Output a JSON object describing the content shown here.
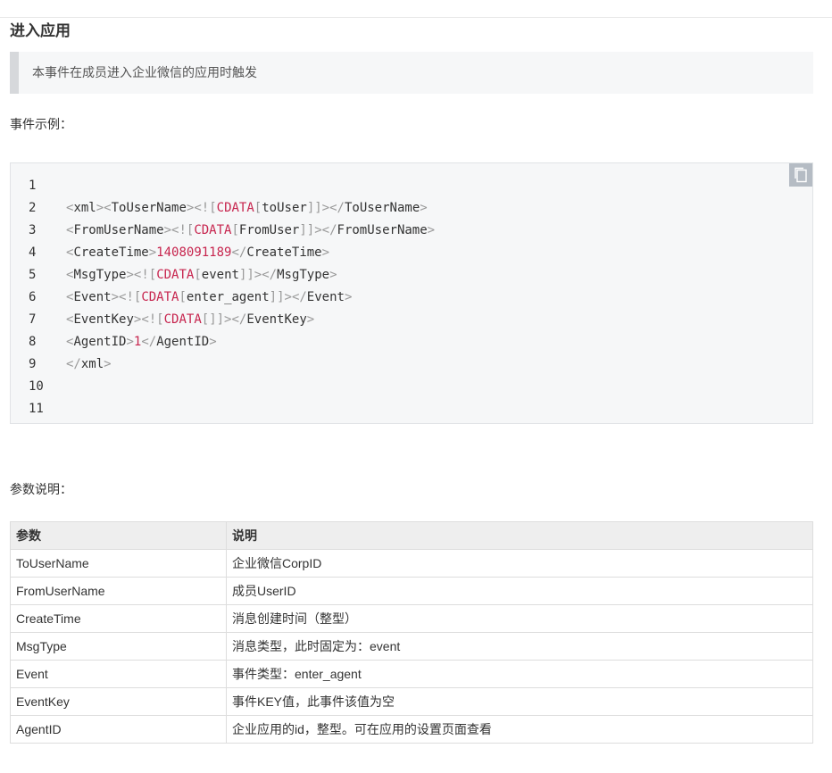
{
  "section": {
    "title": "进入应用",
    "notice": "本事件在成员进入企业微信的应用时触发"
  },
  "example": {
    "label": "事件示例：",
    "copy_icon": "copy-icon",
    "lines": [
      {
        "num": "1",
        "tokens": []
      },
      {
        "num": "2",
        "tokens": [
          {
            "c": "p",
            "t": "<"
          },
          {
            "c": "t",
            "t": "xml"
          },
          {
            "c": "p",
            "t": ">"
          },
          {
            "c": "p",
            "t": "<"
          },
          {
            "c": "t",
            "t": "ToUserName"
          },
          {
            "c": "p",
            "t": ">"
          },
          {
            "c": "p",
            "t": "<!["
          },
          {
            "c": "s",
            "t": "CDATA"
          },
          {
            "c": "p",
            "t": "["
          },
          {
            "c": "t",
            "t": "toUser"
          },
          {
            "c": "p",
            "t": "]]>"
          },
          {
            "c": "p",
            "t": "</"
          },
          {
            "c": "t",
            "t": "ToUserName"
          },
          {
            "c": "p",
            "t": ">"
          }
        ]
      },
      {
        "num": "3",
        "tokens": [
          {
            "c": "p",
            "t": "<"
          },
          {
            "c": "t",
            "t": "FromUserName"
          },
          {
            "c": "p",
            "t": ">"
          },
          {
            "c": "p",
            "t": "<!["
          },
          {
            "c": "s",
            "t": "CDATA"
          },
          {
            "c": "p",
            "t": "["
          },
          {
            "c": "t",
            "t": "FromUser"
          },
          {
            "c": "p",
            "t": "]]>"
          },
          {
            "c": "p",
            "t": "</"
          },
          {
            "c": "t",
            "t": "FromUserName"
          },
          {
            "c": "p",
            "t": ">"
          }
        ]
      },
      {
        "num": "4",
        "tokens": [
          {
            "c": "p",
            "t": "<"
          },
          {
            "c": "t",
            "t": "CreateTime"
          },
          {
            "c": "p",
            "t": ">"
          },
          {
            "c": "s",
            "t": "1408091189"
          },
          {
            "c": "p",
            "t": "</"
          },
          {
            "c": "t",
            "t": "CreateTime"
          },
          {
            "c": "p",
            "t": ">"
          }
        ]
      },
      {
        "num": "5",
        "tokens": [
          {
            "c": "p",
            "t": "<"
          },
          {
            "c": "t",
            "t": "MsgType"
          },
          {
            "c": "p",
            "t": ">"
          },
          {
            "c": "p",
            "t": "<!["
          },
          {
            "c": "s",
            "t": "CDATA"
          },
          {
            "c": "p",
            "t": "["
          },
          {
            "c": "t",
            "t": "event"
          },
          {
            "c": "p",
            "t": "]]>"
          },
          {
            "c": "p",
            "t": "</"
          },
          {
            "c": "t",
            "t": "MsgType"
          },
          {
            "c": "p",
            "t": ">"
          }
        ]
      },
      {
        "num": "6",
        "tokens": [
          {
            "c": "p",
            "t": "<"
          },
          {
            "c": "t",
            "t": "Event"
          },
          {
            "c": "p",
            "t": ">"
          },
          {
            "c": "p",
            "t": "<!["
          },
          {
            "c": "s",
            "t": "CDATA"
          },
          {
            "c": "p",
            "t": "["
          },
          {
            "c": "t",
            "t": "enter_agent"
          },
          {
            "c": "p",
            "t": "]]>"
          },
          {
            "c": "p",
            "t": "</"
          },
          {
            "c": "t",
            "t": "Event"
          },
          {
            "c": "p",
            "t": ">"
          }
        ]
      },
      {
        "num": "7",
        "tokens": [
          {
            "c": "p",
            "t": "<"
          },
          {
            "c": "t",
            "t": "EventKey"
          },
          {
            "c": "p",
            "t": ">"
          },
          {
            "c": "p",
            "t": "<!["
          },
          {
            "c": "s",
            "t": "CDATA"
          },
          {
            "c": "p",
            "t": "[]]>"
          },
          {
            "c": "p",
            "t": "</"
          },
          {
            "c": "t",
            "t": "EventKey"
          },
          {
            "c": "p",
            "t": ">"
          }
        ]
      },
      {
        "num": "8",
        "tokens": [
          {
            "c": "p",
            "t": "<"
          },
          {
            "c": "t",
            "t": "AgentID"
          },
          {
            "c": "p",
            "t": ">"
          },
          {
            "c": "s",
            "t": "1"
          },
          {
            "c": "p",
            "t": "</"
          },
          {
            "c": "t",
            "t": "AgentID"
          },
          {
            "c": "p",
            "t": ">"
          }
        ]
      },
      {
        "num": "9",
        "tokens": [
          {
            "c": "p",
            "t": "</"
          },
          {
            "c": "t",
            "t": "xml"
          },
          {
            "c": "p",
            "t": ">"
          }
        ]
      },
      {
        "num": "10",
        "tokens": []
      },
      {
        "num": "11",
        "tokens": []
      }
    ]
  },
  "params": {
    "label": "参数说明：",
    "headers": [
      "参数",
      "说明"
    ],
    "rows": [
      [
        "ToUserName",
        "企业微信CorpID"
      ],
      [
        "FromUserName",
        "成员UserID"
      ],
      [
        "CreateTime",
        "消息创建时间（整型）"
      ],
      [
        "MsgType",
        "消息类型，此时固定为：event"
      ],
      [
        "Event",
        "事件类型：enter_agent"
      ],
      [
        "EventKey",
        "事件KEY值，此事件该值为空"
      ],
      [
        "AgentID",
        "企业应用的id，整型。可在应用的设置页面查看"
      ]
    ]
  }
}
